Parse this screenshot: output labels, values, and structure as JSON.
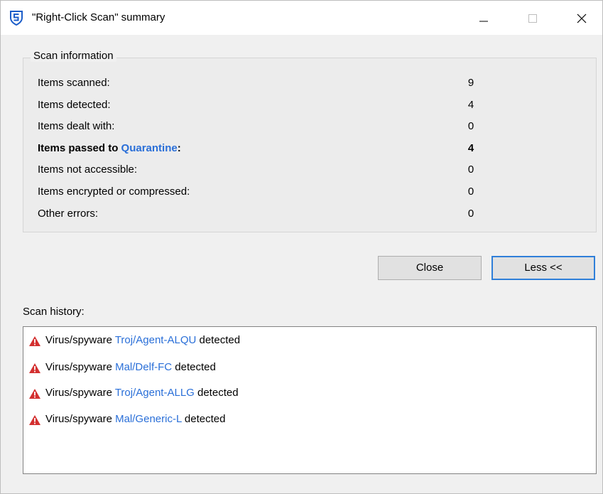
{
  "window": {
    "title": "\"Right-Click Scan\" summary",
    "icon": "sophos-shield-icon",
    "controls": [
      "minimize-icon",
      "maximize-icon",
      "close-icon"
    ]
  },
  "scan_info": {
    "legend": "Scan information",
    "rows": [
      {
        "label": "Items scanned:",
        "value": "9"
      },
      {
        "label": "Items detected:",
        "value": "4"
      },
      {
        "label": "Items dealt with:",
        "value": "0"
      },
      {
        "label_prefix": "Items passed to ",
        "label_link": "Quarantine",
        "label_suffix": ":",
        "value": "4"
      },
      {
        "label": "Items not accessible:",
        "value": "0"
      },
      {
        "label": "Items encrypted or compressed:",
        "value": "0"
      },
      {
        "label": "Other errors:",
        "value": "0"
      }
    ]
  },
  "buttons": {
    "close": "Close",
    "less": "Less <<"
  },
  "history": {
    "label": "Scan history:",
    "icon": "warning-triangle-icon",
    "items": [
      {
        "prefix": "Virus/spyware ",
        "threat": "Troj/Agent-ALQU",
        "suffix": " detected"
      },
      {
        "prefix": "Virus/spyware ",
        "threat": "Mal/Delf-FC",
        "suffix": " detected"
      },
      {
        "prefix": "Virus/spyware ",
        "threat": "Troj/Agent-ALLG",
        "suffix": " detected"
      },
      {
        "prefix": "Virus/spyware ",
        "threat": "Mal/Generic-L",
        "suffix": " detected"
      }
    ]
  },
  "colors": {
    "link": "#2a6fd8",
    "warning": "#d32f2f",
    "focus_border": "#2f7fd9",
    "brand": "#1b5dc9"
  }
}
